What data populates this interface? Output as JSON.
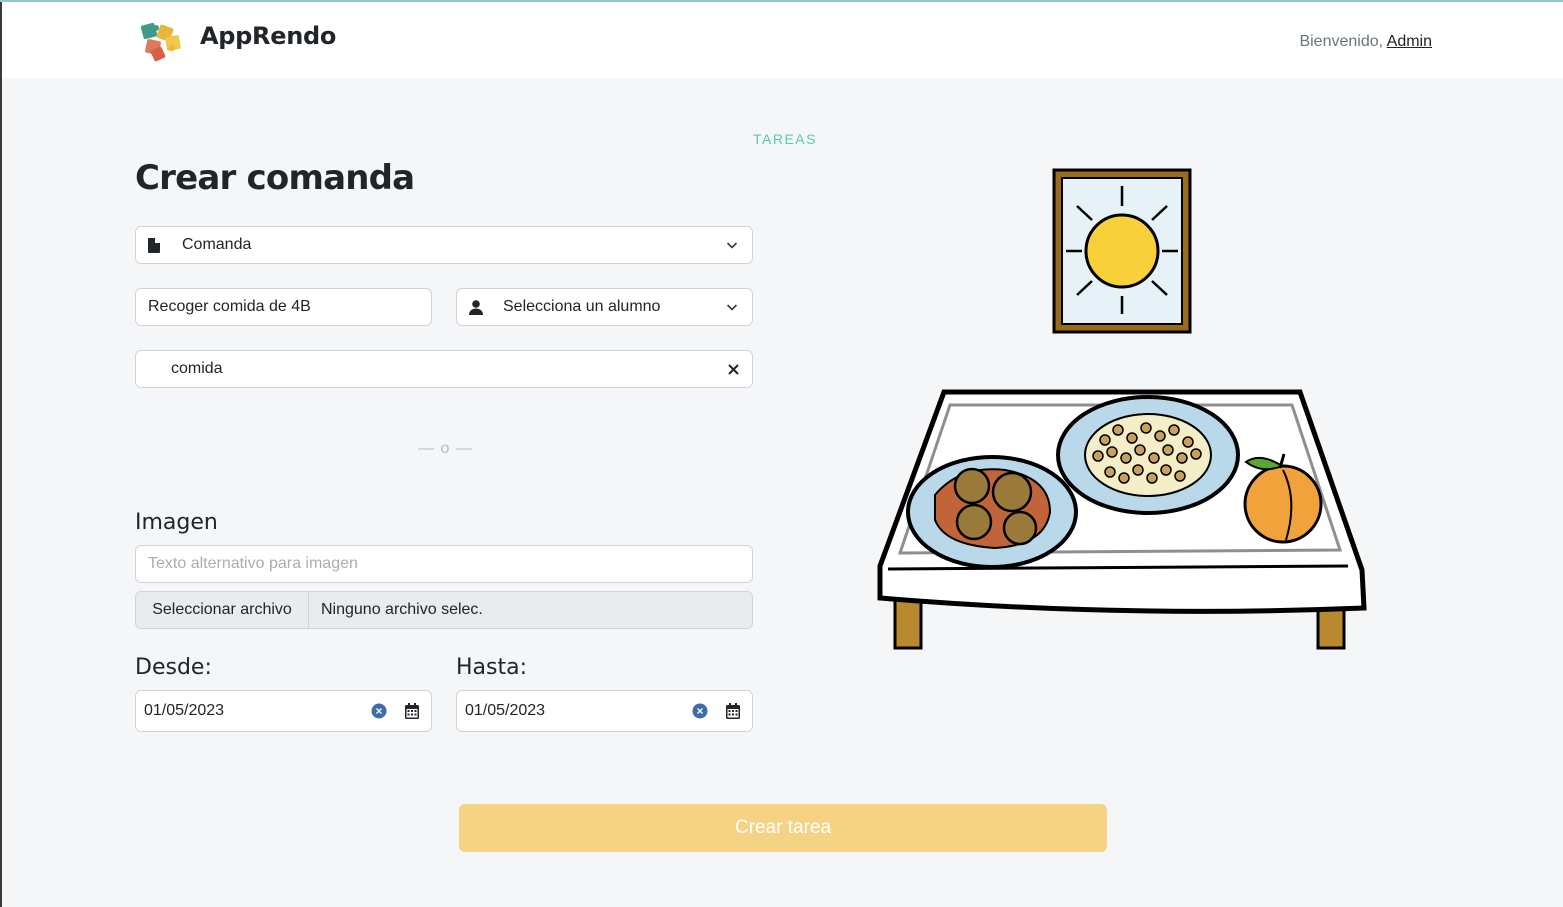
{
  "brand": {
    "name": "AppRendo",
    "logo_icon": "puzzle-logo-icon"
  },
  "header": {
    "welcome_text": "Bienvenido,",
    "user_link": "Admin"
  },
  "kicker": "TAREAS",
  "page_title": "Crear comanda",
  "form": {
    "type_select": {
      "value": "Comanda",
      "icon": "file-icon"
    },
    "task_name": {
      "value": "Recoger comida de 4B"
    },
    "student_select": {
      "value": "Selecciona un alumno",
      "icon": "user-icon"
    },
    "pictogram_search": {
      "value": "comida"
    },
    "divider": "— o —",
    "image_label": "Imagen",
    "image_alt": {
      "placeholder": "Texto alternativo para imagen"
    },
    "file_input": {
      "button": "Seleccionar archivo",
      "status": "Ninguno archivo selec."
    },
    "from_label": "Desde:",
    "from_date": "01/05/2023",
    "to_label": "Hasta:",
    "to_date": "01/05/2023",
    "submit": "Crear tarea"
  },
  "colors": {
    "accent_teal": "#5ec8b3",
    "submit_bg": "#f4d484",
    "clear_blue": "#3a6ea5"
  },
  "illustration": {
    "icon": "table-with-food-pictogram"
  }
}
